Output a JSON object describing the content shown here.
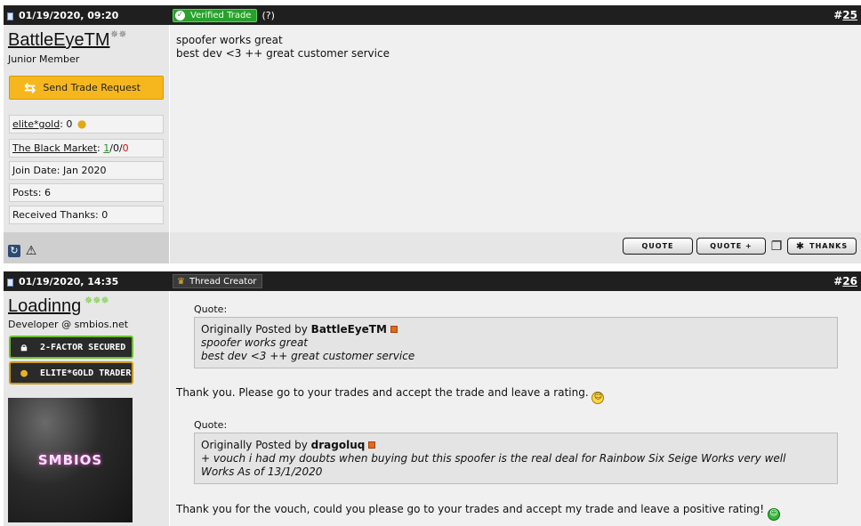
{
  "posts": [
    {
      "date": "01/19/2020, 09:20",
      "number_prefix": "#",
      "number": "25",
      "badge": "Verified Trade",
      "badge_help": "(?)",
      "username": "BattleEyeTM",
      "user_title": "Junior Member",
      "trade_button": "Send Trade Request",
      "info": {
        "gold_label": "elite*gold",
        "gold_value": ": 0",
        "market_label": "The Black Market",
        "market_sep1": ": ",
        "market_pos": "1",
        "market_sep2": "/0/",
        "market_neg": "0",
        "join_date": "Join Date: Jan 2020",
        "posts": "Posts: 6",
        "thanks": "Received Thanks: 0"
      },
      "message_lines": [
        "spoofer works great",
        "best dev <3 ++ great customer service"
      ],
      "buttons": {
        "quote": "QUOTE",
        "quote_plus": "QUOTE +",
        "thanks": "THANKS"
      }
    },
    {
      "date": "01/19/2020, 14:35",
      "number_prefix": "#",
      "number": "26",
      "badge": "Thread Creator",
      "username": "Loadinng",
      "user_title": "Developer @ smbios.net",
      "badges": [
        "2-FACTOR SECURED",
        "ELITE*GOLD TRADER"
      ],
      "avatar_text": "SMBIOS",
      "quotes": [
        {
          "label": "Quote:",
          "prefix": "Originally Posted by ",
          "author": "BattleEyeTM",
          "lines": [
            "spoofer works great",
            "best dev <3 ++ great customer service"
          ]
        },
        {
          "label": "Quote:",
          "prefix": "Originally Posted by ",
          "author": "dragoluq",
          "lines": [
            "+ vouch i had my doubts when buying but this spoofer is the real deal for Rainbow Six Seige Works very well",
            "Works As of 13/1/2020"
          ]
        }
      ],
      "replies": [
        "Thank you. Please go to your trades and accept the trade and leave a rating.",
        "Thank you for the vouch, could you please go to your trades and accept my trade and leave a positive rating!"
      ]
    }
  ],
  "icons": {
    "verified": "check-icon",
    "trade": "swap-arrows-icon",
    "gold": "coins-icon",
    "refresh": "refresh-icon",
    "warning": "warning-icon",
    "multiquote": "multiquote-icon",
    "thanks": "asterisk-icon",
    "crown": "crown-icon",
    "lock": "lock-icon",
    "smiley": "smiley-icon",
    "grin": "grin-icon"
  },
  "colors": {
    "header_bg": "#1f1f1f",
    "verified_green": "#28a12b",
    "trade_button": "#f6b71e",
    "positive": "#2e8b2e",
    "negative": "#cc1111"
  }
}
